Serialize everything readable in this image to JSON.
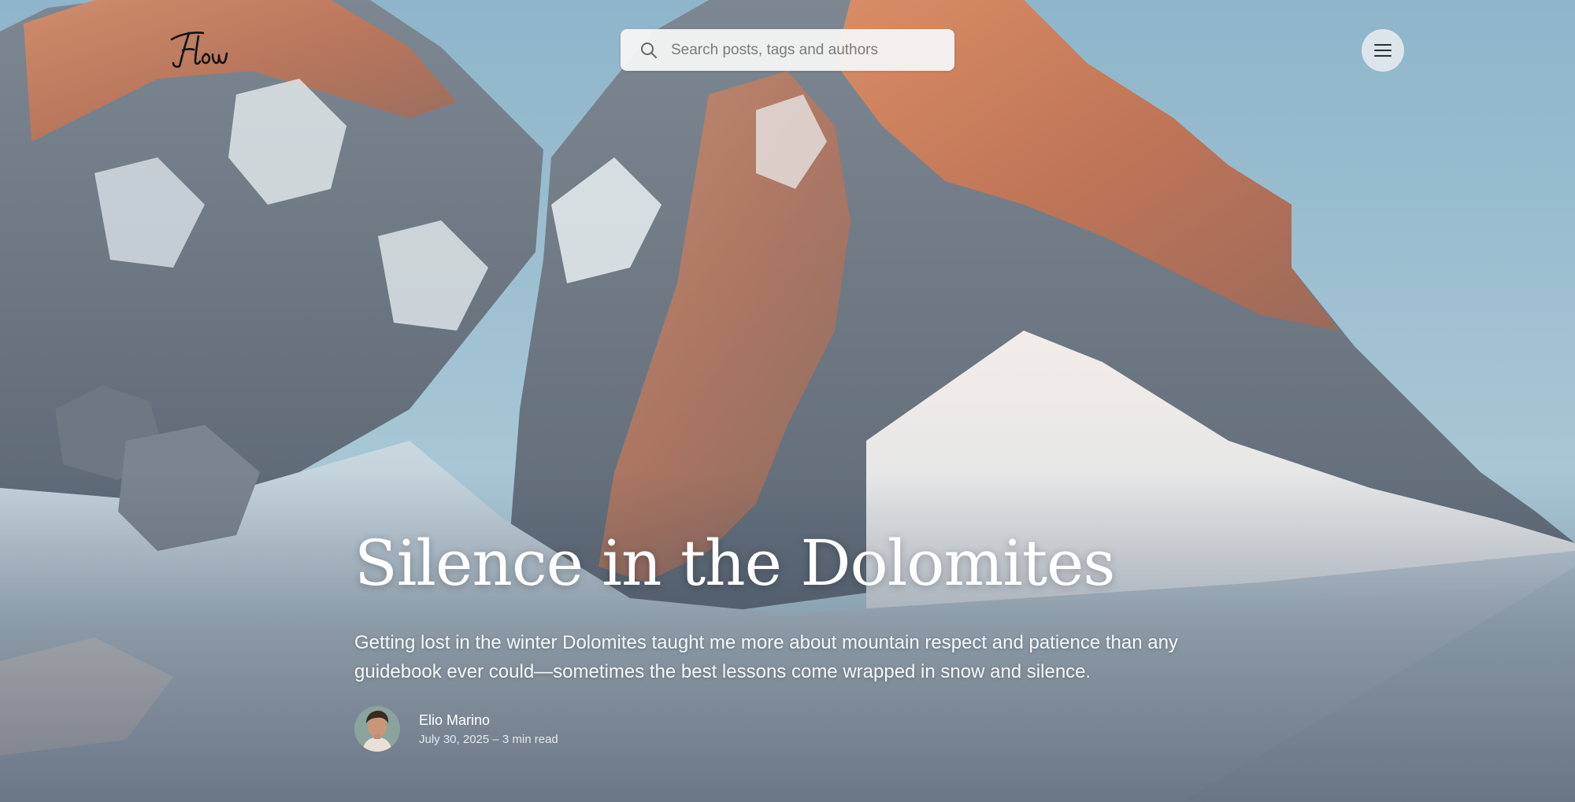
{
  "site": {
    "logo_text": "Flow"
  },
  "search": {
    "placeholder": "Search posts, tags and authors"
  },
  "menu": {
    "icon": "hamburger-menu-icon"
  },
  "post": {
    "title": "Silence in the Dolomites",
    "excerpt": "Getting lost in the winter Dolomites taught me more about mountain respect and patience than any guidebook ever could—sometimes the best lessons come wrapped in snow and silence.",
    "author": {
      "name": "Elio Marino",
      "avatar_icon": "author-avatar"
    },
    "date": "July 30, 2025",
    "read_time": "3 min read",
    "meta_line": "July 30, 2025 – 3 min read"
  },
  "colors": {
    "sky": "#9fc3d6",
    "rock_orange": "#c9825f",
    "rock_grey": "#6e7a84",
    "snow": "#eef2f4",
    "text": "#ffffff"
  }
}
